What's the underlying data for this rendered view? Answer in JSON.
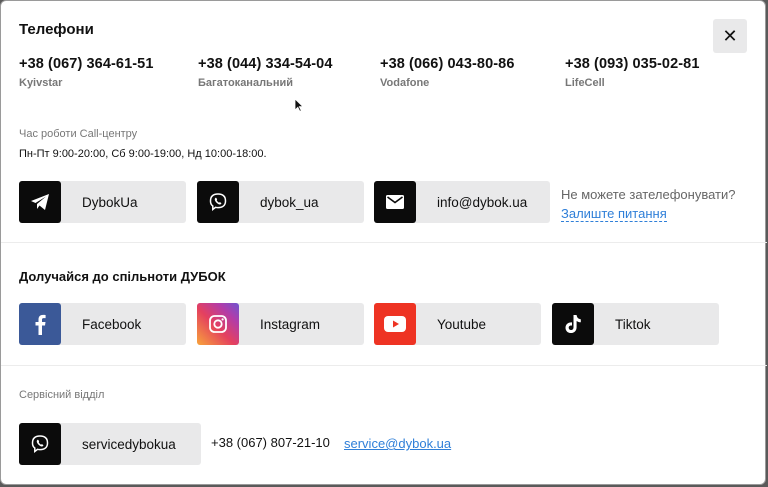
{
  "modal": {
    "title": "Телефони",
    "close_label": "✕"
  },
  "phones": [
    {
      "number": "+38 (067) 364-61-51",
      "operator": "Kyivstar"
    },
    {
      "number": "+38 (044) 334-54-04",
      "operator": "Багатоканальний"
    },
    {
      "number": "+38 (066) 043-80-86",
      "operator": "Vodafone"
    },
    {
      "number": "+38 (093) 035-02-81",
      "operator": "LifeCell"
    }
  ],
  "call_center": {
    "label": "Час роботи Call-центру",
    "hours": "Пн-Пт 9:00-20:00, Сб 9:00-19:00, Нд 10:00-18:00."
  },
  "contacts": [
    {
      "label": "DybokUa",
      "icon": "telegram-icon"
    },
    {
      "label": "dybok_ua",
      "icon": "viber-icon"
    },
    {
      "label": "info@dybok.ua",
      "icon": "mail-icon"
    }
  ],
  "callback": {
    "question": "Не можете зателефонувати?",
    "link": "Залиште питання"
  },
  "community": {
    "title": "Долучайся до спільноти ДУБОК",
    "items": [
      {
        "label": "Facebook",
        "icon": "facebook-icon",
        "color": "#3b5998"
      },
      {
        "label": "Instagram",
        "icon": "instagram-icon",
        "color": "#e4405f"
      },
      {
        "label": "Youtube",
        "icon": "youtube-icon",
        "color": "#ee3323"
      },
      {
        "label": "Tiktok",
        "icon": "tiktok-icon",
        "color": "#0b0b0b"
      }
    ]
  },
  "service": {
    "label": "Сервісний відділ",
    "viber": "servicedybokua",
    "phone": "+38 (067) 807-21-10",
    "email": "service@dybok.ua"
  },
  "colors": {
    "link": "#2f7fd8",
    "chip_bg": "#e9e9ea",
    "icon_bg": "#0b0b0b"
  }
}
